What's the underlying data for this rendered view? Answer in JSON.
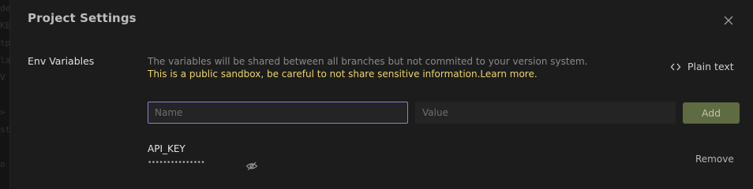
{
  "modal": {
    "title": "Project Settings"
  },
  "backdrop": {
    "code_fragments": "de\nKE\ntp\nla\nV\n\n>\nst\n\no\n"
  },
  "env": {
    "section_label": "Env Variables",
    "description": "The variables will be shared between all branches but not commited to your version system.",
    "warning": "This is a public sandbox, be careful to not share sensitive information.",
    "learn_more": "Learn more.",
    "plain_text_label": "Plain text",
    "name_placeholder": "Name",
    "value_placeholder": "Value",
    "add_label": "Add",
    "variables": [
      {
        "key": "API_KEY",
        "masked_value": "•••••••••••••••",
        "remove_label": "Remove"
      }
    ]
  },
  "colors": {
    "accent_focus": "#8c7fd6",
    "warning_text": "#e9d46a",
    "add_button_bg": "#5f6b42"
  },
  "icons": {
    "close": "close-icon",
    "plain_text": "code-icon",
    "visibility": "eye-off-icon"
  }
}
